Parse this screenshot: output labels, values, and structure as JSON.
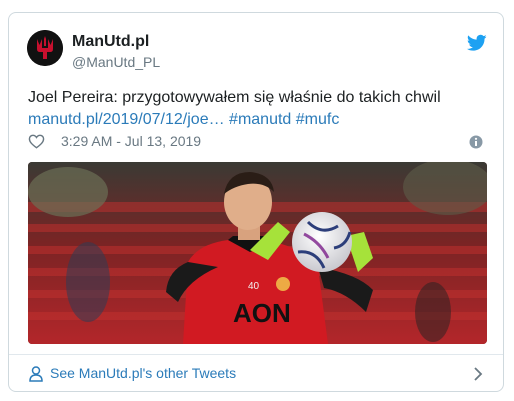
{
  "author": {
    "name": "ManUtd.pl",
    "handle": "@ManUtd_PL",
    "avatar_icon": "devil-trident-logo-icon"
  },
  "tweet": {
    "text": "Joel Pereira: przygotowywałem się właśnie do takich chwil",
    "link": "manutd.pl/2019/07/12/joe…",
    "hashtags": [
      "#manutd",
      "#mufc"
    ],
    "timestamp": "3:29 AM - Jul 13, 2019"
  },
  "media": {
    "jersey_sponsor": "AON",
    "jersey_number": "40"
  },
  "footer": {
    "label": "See ManUtd.pl's other Tweets"
  },
  "colors": {
    "link": "#2b7bb9",
    "muted": "#697882",
    "twitter_blue": "#1da1f2",
    "border": "#cfd9de"
  }
}
